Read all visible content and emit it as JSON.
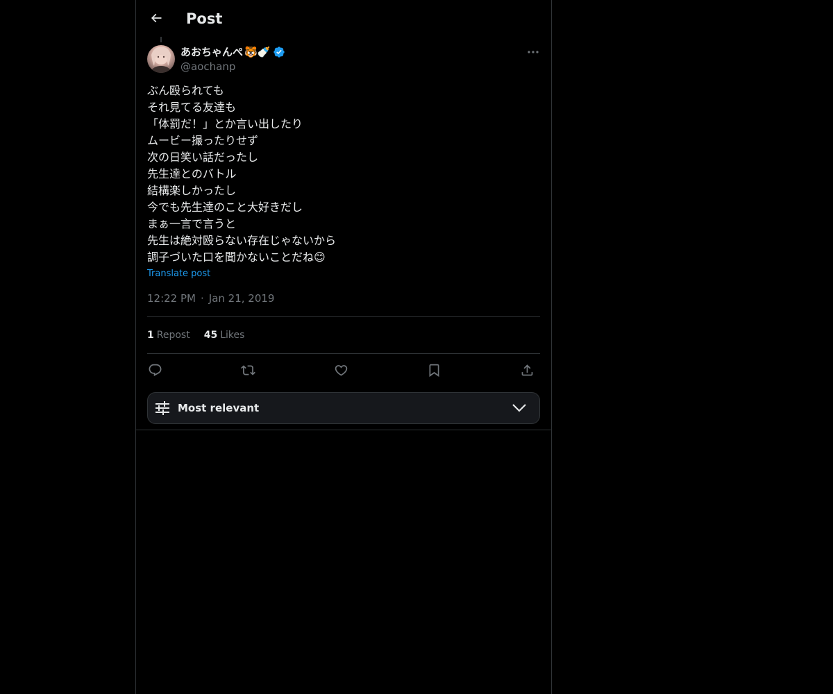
{
  "header": {
    "title": "Post"
  },
  "author": {
    "display_name": "あおちゃんぺ",
    "name_emojis": "🐯🍼",
    "handle": "@aochanp",
    "verified": true,
    "verified_color": "#1d9bf0"
  },
  "post": {
    "lines": [
      "ぶん殴られても",
      "それ見てる友達も",
      "「体罰だ！」とか言い出したり",
      "ムービー撮ったりせず",
      "次の日笑い話だったし",
      "先生達とのバトル",
      "結構楽しかったし",
      "今でも先生達のこと大好きだし",
      "まぁ一言で言うと",
      "先生は絶対殴らない存在じゃないから",
      "調子づいた口を聞かないことだね😊"
    ],
    "translate_label": "Translate post",
    "time": "12:22 PM",
    "date": "Jan 21, 2019",
    "separator": "·"
  },
  "stats": {
    "reposts_count": "1",
    "reposts_label": "Repost",
    "likes_count": "45",
    "likes_label": "Likes"
  },
  "actions": {
    "icons": [
      "reply-icon",
      "repost-icon",
      "like-icon",
      "bookmark-icon",
      "share-icon"
    ]
  },
  "sort": {
    "label": "Most relevant"
  },
  "colors": {
    "background": "#000000",
    "text": "#e7e9ea",
    "muted": "#71767b",
    "link": "#1d9bf0",
    "border": "#2f3336"
  }
}
